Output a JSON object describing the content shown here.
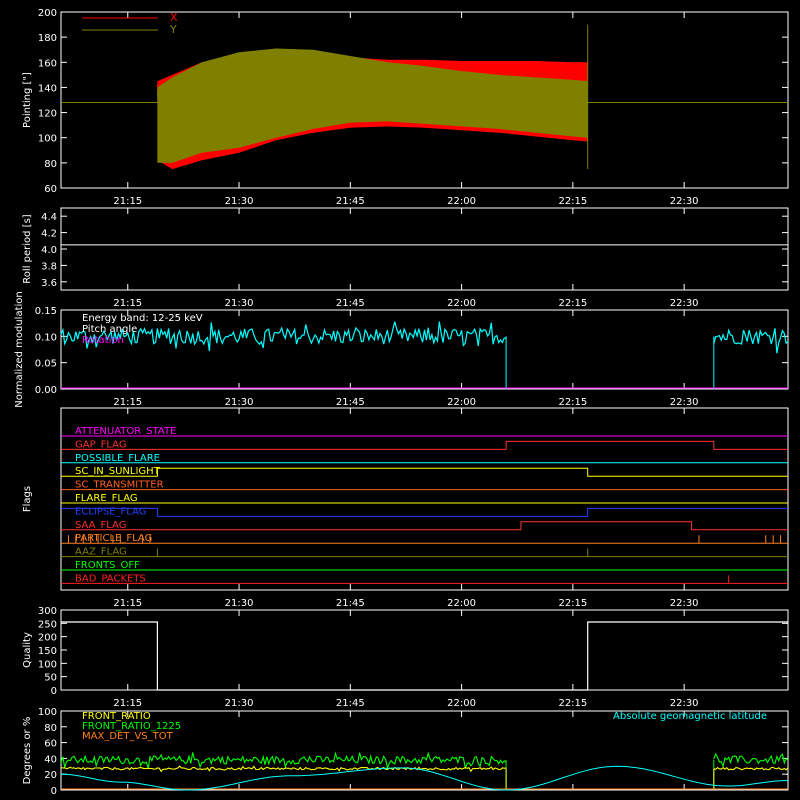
{
  "panels": [
    {
      "id": "pointing",
      "ylabel": "Pointing [\"]",
      "yticks": [
        "60",
        "80",
        "100",
        "120",
        "140",
        "160",
        "180",
        "200"
      ],
      "legend": [
        {
          "label": "X",
          "color": "#ff0000"
        },
        {
          "label": "Y",
          "color": "#808000"
        }
      ]
    },
    {
      "id": "roll",
      "ylabel": "Roll period [s]",
      "yticks": [
        "3.6",
        "3.8",
        "4.0",
        "4.2",
        "4.4"
      ]
    },
    {
      "id": "modulation",
      "ylabel": "Normalized modulation",
      "yticks": [
        "0.00",
        "0.05",
        "0.10",
        "0.15"
      ],
      "annotations": [
        "Energy band: 12-25 keV",
        "Pitch angle",
        "Rotation"
      ]
    },
    {
      "id": "flags",
      "ylabel": "Flags",
      "flag_names": [
        "ATTENUATOR_STATE",
        "GAP_FLAG",
        "POSSIBLE_FLARE",
        "SC_IN_SUNLIGHT",
        "SC_TRANSMITTER",
        "FLARE_FLAG",
        "ECLIPSE_FLAG",
        "SAA_FLAG",
        "PARTICLE_FLAG",
        "AAZ_FLAG",
        "FRONTS_OFF",
        "BAD_PACKETS"
      ],
      "flag_colors": [
        "#ff00ff",
        "#ff3030",
        "#00ffff",
        "#ffff00",
        "#ff6020",
        "#ffff00",
        "#2040ff",
        "#ff3030",
        "#ff8020",
        "#808000",
        "#00ff00",
        "#ff2020"
      ]
    },
    {
      "id": "quality",
      "ylabel": "Quality",
      "yticks": [
        "0",
        "50",
        "100",
        "150",
        "200",
        "250",
        "300"
      ]
    },
    {
      "id": "ratios",
      "ylabel": "Degrees or %",
      "yticks": [
        "0",
        "20",
        "40",
        "60",
        "80",
        "100"
      ],
      "legend": [
        {
          "label": "FRONT_RATIO",
          "color": "#ffff00"
        },
        {
          "label": "FRONT_RATIO_1225",
          "color": "#00ff00"
        },
        {
          "label": "MAX_DET_VS_TOT",
          "color": "#ff8020"
        }
      ],
      "right_label": "Absolute geomagnetic latitude",
      "right_color": "#00ffff"
    }
  ],
  "xticks": [
    "21:15",
    "21:30",
    "21:45",
    "22:00",
    "22:15",
    "22:30"
  ],
  "chart_data": [
    {
      "type": "line",
      "title": "",
      "ylabel": "Pointing [\"]",
      "ylim": [
        60,
        200
      ],
      "xlim": [
        "21:06",
        "22:44"
      ],
      "series": [
        {
          "name": "X",
          "color": "#ff0000",
          "x": [
            "21:19",
            "21:21",
            "21:25",
            "21:30",
            "21:35",
            "21:40",
            "21:45",
            "21:50",
            "21:55",
            "22:00",
            "22:05",
            "22:10",
            "22:15",
            "22:17"
          ],
          "max": [
            145,
            150,
            160,
            165,
            168,
            167,
            164,
            162,
            162,
            161,
            161,
            161,
            160,
            160
          ],
          "min": [
            82,
            75,
            82,
            88,
            98,
            104,
            108,
            109,
            108,
            106,
            104,
            101,
            98,
            97
          ]
        },
        {
          "name": "Y",
          "color": "#808000",
          "x": [
            "21:19",
            "21:21",
            "21:25",
            "21:30",
            "21:35",
            "21:40",
            "21:45",
            "21:50",
            "21:55",
            "22:00",
            "22:05",
            "22:10",
            "22:15",
            "22:17"
          ],
          "max": [
            140,
            148,
            160,
            168,
            171,
            170,
            165,
            160,
            157,
            153,
            150,
            148,
            146,
            145
          ],
          "min": [
            80,
            80,
            88,
            92,
            100,
            107,
            112,
            113,
            111,
            109,
            107,
            104,
            101,
            100
          ],
          "baseline": 128
        }
      ]
    },
    {
      "type": "line",
      "ylabel": "Roll period [s]",
      "ylim": [
        3.5,
        4.5
      ],
      "series": [
        {
          "name": "",
          "color": "#ffffff",
          "x": [
            "21:06",
            "22:44"
          ],
          "y": [
            4.05,
            4.05
          ]
        }
      ]
    },
    {
      "type": "line",
      "ylabel": "Normalized modulation",
      "ylim": [
        0,
        0.15
      ],
      "series": [
        {
          "name": "",
          "color": "#00ffff",
          "segments": [
            [
              "21:06",
              "22:06"
            ],
            [
              "22:34",
              "22:44"
            ]
          ],
          "mean": 0.1,
          "spread": 0.03
        },
        {
          "name": "",
          "color": "#ff00ff",
          "x": [
            "21:06",
            "22:44"
          ],
          "y": [
            0,
            0
          ]
        }
      ]
    },
    {
      "type": "line",
      "ylabel": "Flags",
      "series": [
        {
          "name": "ATTENUATOR_STATE",
          "steps": []
        },
        {
          "name": "GAP_FLAG",
          "steps": [
            [
              "22:06",
              "22:34"
            ]
          ]
        },
        {
          "name": "POSSIBLE_FLARE",
          "steps": []
        },
        {
          "name": "SC_IN_SUNLIGHT",
          "steps": [
            [
              "21:19",
              "22:17"
            ]
          ]
        },
        {
          "name": "SC_TRANSMITTER",
          "steps": []
        },
        {
          "name": "FLARE_FLAG",
          "steps": []
        },
        {
          "name": "ECLIPSE_FLAG",
          "steps_low": [
            [
              "21:19",
              "22:17"
            ]
          ]
        },
        {
          "name": "SAA_FLAG",
          "steps": [
            [
              "22:08",
              "22:31"
            ]
          ]
        },
        {
          "name": "PARTICLE_FLAG",
          "pulses": [
            "21:07",
            "21:08",
            "21:09",
            "21:10",
            "21:11",
            "21:13",
            "21:14",
            "21:17",
            "21:18",
            "22:32",
            "22:41",
            "22:42",
            "22:43"
          ]
        },
        {
          "name": "AAZ_FLAG",
          "pulses": [
            "21:19",
            "22:17"
          ]
        },
        {
          "name": "FRONTS_OFF",
          "steps": []
        },
        {
          "name": "BAD_PACKETS",
          "pulses": [
            "22:36"
          ]
        }
      ]
    },
    {
      "type": "line",
      "ylabel": "Quality",
      "ylim": [
        0,
        300
      ],
      "series": [
        {
          "name": "",
          "color": "#ffffff",
          "x": [
            "21:06",
            "21:19",
            "21:19",
            "22:17",
            "22:17",
            "22:44"
          ],
          "y": [
            255,
            255,
            0,
            0,
            255,
            255
          ]
        }
      ]
    },
    {
      "type": "line",
      "ylabel": "Degrees or %",
      "ylim": [
        0,
        100
      ],
      "series": [
        {
          "name": "FRONT_RATIO",
          "color": "#ffff00",
          "segments": [
            [
              "21:06",
              "22:06"
            ],
            [
              "22:34",
              "22:44"
            ]
          ],
          "mean": 27,
          "spread": 3
        },
        {
          "name": "FRONT_RATIO_1225",
          "color": "#00ff00",
          "segments": [
            [
              "21:06",
              "22:06"
            ],
            [
              "22:34",
              "22:44"
            ]
          ],
          "mean": 38,
          "spread": 10
        },
        {
          "name": "MAX_DET_VS_TOT",
          "color": "#ff8020",
          "x": [
            "21:06",
            "22:44"
          ],
          "y": [
            0,
            0
          ]
        },
        {
          "name": "Absolute geomagnetic latitude",
          "color": "#00ffff",
          "x": [
            "21:06",
            "21:14",
            "21:23",
            "21:37",
            "21:52",
            "22:06",
            "22:21",
            "22:36",
            "22:44"
          ],
          "y": [
            20,
            10,
            0,
            18,
            28,
            0,
            30,
            5,
            12
          ]
        }
      ]
    }
  ]
}
